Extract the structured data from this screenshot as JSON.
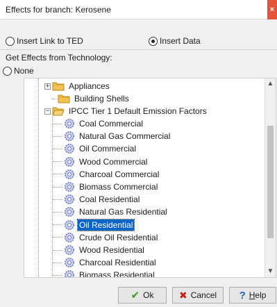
{
  "window": {
    "title": "Effects for branch: Kerosene",
    "close_glyph": "×"
  },
  "options": {
    "link_label": "Insert Link to TED",
    "data_label": "Insert Data",
    "selected": "Insert Data"
  },
  "technology": {
    "group_label": "Get Effects from Technology:",
    "none_label": "None"
  },
  "tree": {
    "folders": [
      {
        "label": "Appliances",
        "expander": "+"
      },
      {
        "label": "Building Shells",
        "expander": ""
      },
      {
        "label": "IPCC Tier 1 Default Emission Factors",
        "expander": "−"
      }
    ],
    "items": [
      "Coal Commercial",
      "Natural Gas Commercial",
      "Oil Commercial",
      "Wood Commercial",
      "Charcoal Commercial",
      "Biomass Commercial",
      "Coal Residential",
      "Natural Gas Residential",
      "Oil Residential",
      "Crude Oil Residential",
      "Wood Residential",
      "Charcoal Residential",
      "Biomass Residential"
    ],
    "selected_item": "Oil Residential"
  },
  "buttons": {
    "ok": "Ok",
    "cancel": "Cancel",
    "help_first": "H",
    "help_rest": "elp"
  },
  "colors": {
    "selection": "#0a64c8",
    "ok_check": "#3a9a2a",
    "cancel_x": "#c62020",
    "help_q": "#1e5fbf",
    "close": "#e5533b",
    "folder": "#f2c14e"
  },
  "icons": {
    "folder": "folder-icon",
    "item": "gear-icon",
    "ok": "check-icon",
    "cancel": "x-icon",
    "help": "question-icon"
  }
}
